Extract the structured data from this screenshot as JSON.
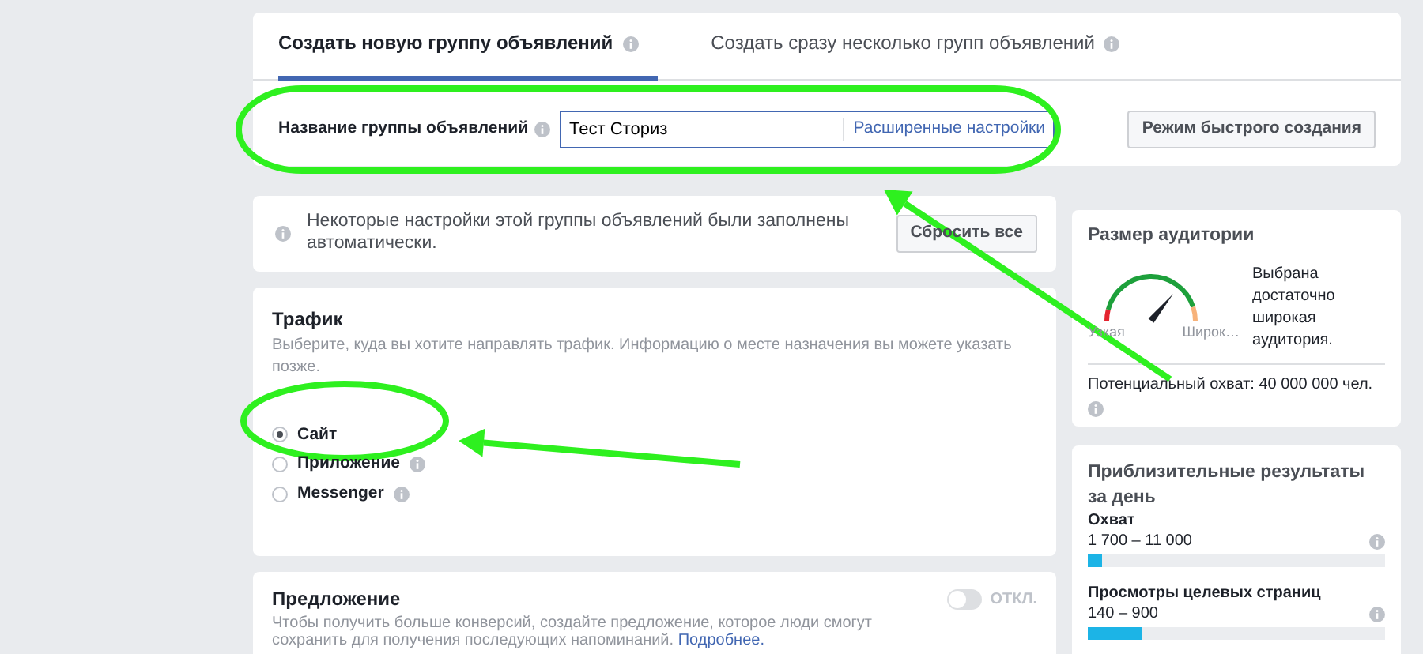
{
  "tabs": [
    {
      "label": "Создать новую группу объявлений",
      "selected": true
    },
    {
      "label": "Создать сразу несколько групп объявлений",
      "selected": false
    }
  ],
  "ad_set_name": {
    "label": "Название группы объявлений",
    "value": "Тест Сториз",
    "link": "Расширенные настройки"
  },
  "quick_create_button": "Режим быстрого создания",
  "notice": {
    "text": "Некоторые настройки этой группы объявлений были заполнены автоматически.",
    "button": "Сбросить все"
  },
  "traffic": {
    "title": "Трафик",
    "description": "Выберите, куда вы хотите направлять трафик. Информацию о месте назначения вы можете указать позже.",
    "options": [
      {
        "label": "Сайт",
        "selected": true,
        "info": false
      },
      {
        "label": "Приложение",
        "selected": false,
        "info": true
      },
      {
        "label": "Messenger",
        "selected": false,
        "info": true
      }
    ]
  },
  "offer": {
    "title": "Предложение",
    "description": "Чтобы получить больше конверсий, создайте предложение, которое люди смогут сохранить для получения последующих напоминаний.",
    "link": "Подробнее.",
    "toggle": {
      "on": false,
      "label": "ОТКЛ."
    }
  },
  "audience": {
    "title": "Размер аудитории",
    "gauge": {
      "min_label": "Узкая",
      "max_label": "Широк…"
    },
    "summary": "Выбрана достаточно широкая аудитория.",
    "potential_reach": "Потенциальный охват: 40 000 000 чел."
  },
  "daily_results": {
    "title": "Приблизительные результаты за день",
    "metrics": [
      {
        "label": "Охват",
        "range": "1 700 – 11 000",
        "level": 0.05
      },
      {
        "label": "Просмотры целевых страниц",
        "range": "140 – 900",
        "level": 0.18
      }
    ]
  },
  "annotations": [
    {
      "kind": "ellipse"
    },
    {
      "kind": "ellipse"
    },
    {
      "kind": "arrow"
    },
    {
      "kind": "arrow"
    }
  ]
}
